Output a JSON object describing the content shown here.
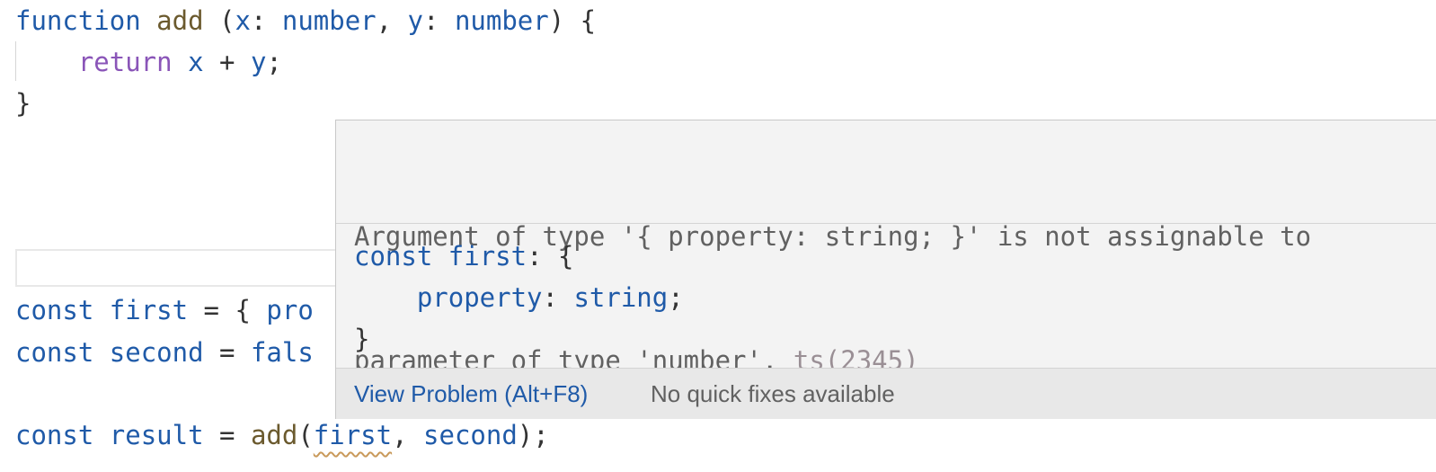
{
  "editor": {
    "lines": [
      {
        "tokens": [
          [
            "kw",
            "function"
          ],
          [
            "pn",
            " "
          ],
          [
            "fn",
            "add"
          ],
          [
            "pn",
            " ("
          ],
          [
            "id",
            "x"
          ],
          [
            "pn",
            ": "
          ],
          [
            "id",
            "number"
          ],
          [
            "pn",
            ", "
          ],
          [
            "id",
            "y"
          ],
          [
            "pn",
            ": "
          ],
          [
            "id",
            "number"
          ],
          [
            "pn",
            ") {"
          ]
        ]
      },
      {
        "tokens": [
          [
            "pn",
            "    "
          ],
          [
            "ctl",
            "return"
          ],
          [
            "pn",
            " "
          ],
          [
            "id",
            "x"
          ],
          [
            "pn",
            " + "
          ],
          [
            "id",
            "y"
          ],
          [
            "pn",
            ";"
          ]
        ]
      },
      {
        "tokens": [
          [
            "pn",
            "}"
          ]
        ]
      },
      {
        "tokens": []
      },
      {
        "tokens": []
      },
      {
        "tokens": []
      },
      {
        "tokens": []
      },
      {
        "tokens": [
          [
            "kw",
            "const"
          ],
          [
            "pn",
            " "
          ],
          [
            "id",
            "first"
          ],
          [
            "pn",
            " = { "
          ],
          [
            "id",
            "pro"
          ]
        ]
      },
      {
        "tokens": [
          [
            "kw",
            "const"
          ],
          [
            "pn",
            " "
          ],
          [
            "id",
            "second"
          ],
          [
            "pn",
            " = "
          ],
          [
            "kw",
            "fals"
          ]
        ]
      },
      {
        "tokens": []
      },
      {
        "tokens": [
          [
            "kw",
            "const"
          ],
          [
            "pn",
            " "
          ],
          [
            "id",
            "result"
          ],
          [
            "pn",
            " = "
          ],
          [
            "fn",
            "add"
          ],
          [
            "pn",
            "("
          ],
          [
            "id",
            "first",
            "squiggle"
          ],
          [
            "pn",
            ", "
          ],
          [
            "id",
            "second"
          ],
          [
            "pn",
            ");"
          ]
        ]
      }
    ]
  },
  "hover": {
    "message_line1": "Argument of type '{ property: string; }' is not assignable to",
    "message_line2": "parameter of type 'number'. ",
    "error_code": "ts(2345)",
    "code_lines": [
      [
        [
          "kw",
          "const"
        ],
        [
          "pn",
          " "
        ],
        [
          "id",
          "first"
        ],
        [
          "pn",
          ": {"
        ]
      ],
      [
        [
          "pn",
          "    "
        ],
        [
          "id",
          "property"
        ],
        [
          "pn",
          ": "
        ],
        [
          "id",
          "string"
        ],
        [
          "pn",
          ";"
        ]
      ],
      [
        [
          "pn",
          "}"
        ]
      ]
    ],
    "view_problem": "View Problem (Alt+F8)",
    "no_fixes": "No quick fixes available"
  }
}
